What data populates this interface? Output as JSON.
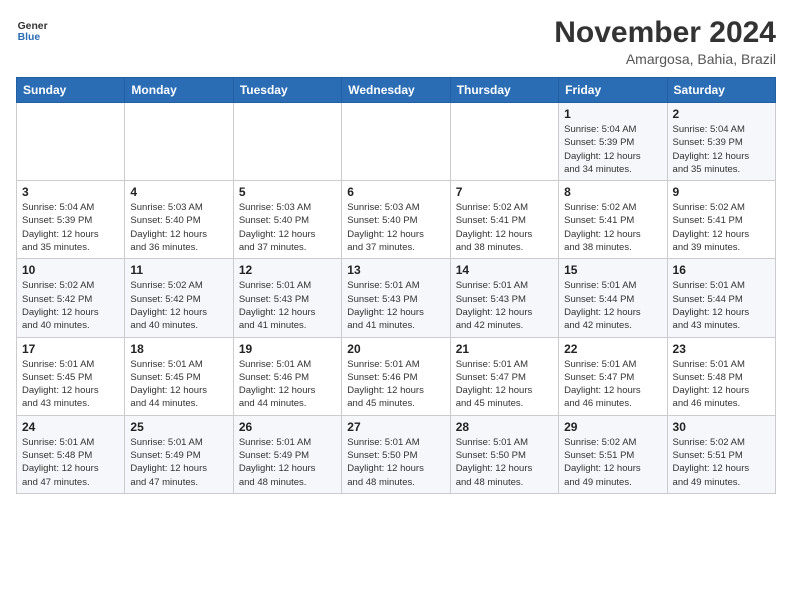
{
  "logo": {
    "line1": "General",
    "line2": "Blue"
  },
  "title": "November 2024",
  "location": "Amargosa, Bahia, Brazil",
  "days_of_week": [
    "Sunday",
    "Monday",
    "Tuesday",
    "Wednesday",
    "Thursday",
    "Friday",
    "Saturday"
  ],
  "weeks": [
    [
      {
        "day": "",
        "info": ""
      },
      {
        "day": "",
        "info": ""
      },
      {
        "day": "",
        "info": ""
      },
      {
        "day": "",
        "info": ""
      },
      {
        "day": "",
        "info": ""
      },
      {
        "day": "1",
        "info": "Sunrise: 5:04 AM\nSunset: 5:39 PM\nDaylight: 12 hours\nand 34 minutes."
      },
      {
        "day": "2",
        "info": "Sunrise: 5:04 AM\nSunset: 5:39 PM\nDaylight: 12 hours\nand 35 minutes."
      }
    ],
    [
      {
        "day": "3",
        "info": "Sunrise: 5:04 AM\nSunset: 5:39 PM\nDaylight: 12 hours\nand 35 minutes."
      },
      {
        "day": "4",
        "info": "Sunrise: 5:03 AM\nSunset: 5:40 PM\nDaylight: 12 hours\nand 36 minutes."
      },
      {
        "day": "5",
        "info": "Sunrise: 5:03 AM\nSunset: 5:40 PM\nDaylight: 12 hours\nand 37 minutes."
      },
      {
        "day": "6",
        "info": "Sunrise: 5:03 AM\nSunset: 5:40 PM\nDaylight: 12 hours\nand 37 minutes."
      },
      {
        "day": "7",
        "info": "Sunrise: 5:02 AM\nSunset: 5:41 PM\nDaylight: 12 hours\nand 38 minutes."
      },
      {
        "day": "8",
        "info": "Sunrise: 5:02 AM\nSunset: 5:41 PM\nDaylight: 12 hours\nand 38 minutes."
      },
      {
        "day": "9",
        "info": "Sunrise: 5:02 AM\nSunset: 5:41 PM\nDaylight: 12 hours\nand 39 minutes."
      }
    ],
    [
      {
        "day": "10",
        "info": "Sunrise: 5:02 AM\nSunset: 5:42 PM\nDaylight: 12 hours\nand 40 minutes."
      },
      {
        "day": "11",
        "info": "Sunrise: 5:02 AM\nSunset: 5:42 PM\nDaylight: 12 hours\nand 40 minutes."
      },
      {
        "day": "12",
        "info": "Sunrise: 5:01 AM\nSunset: 5:43 PM\nDaylight: 12 hours\nand 41 minutes."
      },
      {
        "day": "13",
        "info": "Sunrise: 5:01 AM\nSunset: 5:43 PM\nDaylight: 12 hours\nand 41 minutes."
      },
      {
        "day": "14",
        "info": "Sunrise: 5:01 AM\nSunset: 5:43 PM\nDaylight: 12 hours\nand 42 minutes."
      },
      {
        "day": "15",
        "info": "Sunrise: 5:01 AM\nSunset: 5:44 PM\nDaylight: 12 hours\nand 42 minutes."
      },
      {
        "day": "16",
        "info": "Sunrise: 5:01 AM\nSunset: 5:44 PM\nDaylight: 12 hours\nand 43 minutes."
      }
    ],
    [
      {
        "day": "17",
        "info": "Sunrise: 5:01 AM\nSunset: 5:45 PM\nDaylight: 12 hours\nand 43 minutes."
      },
      {
        "day": "18",
        "info": "Sunrise: 5:01 AM\nSunset: 5:45 PM\nDaylight: 12 hours\nand 44 minutes."
      },
      {
        "day": "19",
        "info": "Sunrise: 5:01 AM\nSunset: 5:46 PM\nDaylight: 12 hours\nand 44 minutes."
      },
      {
        "day": "20",
        "info": "Sunrise: 5:01 AM\nSunset: 5:46 PM\nDaylight: 12 hours\nand 45 minutes."
      },
      {
        "day": "21",
        "info": "Sunrise: 5:01 AM\nSunset: 5:47 PM\nDaylight: 12 hours\nand 45 minutes."
      },
      {
        "day": "22",
        "info": "Sunrise: 5:01 AM\nSunset: 5:47 PM\nDaylight: 12 hours\nand 46 minutes."
      },
      {
        "day": "23",
        "info": "Sunrise: 5:01 AM\nSunset: 5:48 PM\nDaylight: 12 hours\nand 46 minutes."
      }
    ],
    [
      {
        "day": "24",
        "info": "Sunrise: 5:01 AM\nSunset: 5:48 PM\nDaylight: 12 hours\nand 47 minutes."
      },
      {
        "day": "25",
        "info": "Sunrise: 5:01 AM\nSunset: 5:49 PM\nDaylight: 12 hours\nand 47 minutes."
      },
      {
        "day": "26",
        "info": "Sunrise: 5:01 AM\nSunset: 5:49 PM\nDaylight: 12 hours\nand 48 minutes."
      },
      {
        "day": "27",
        "info": "Sunrise: 5:01 AM\nSunset: 5:50 PM\nDaylight: 12 hours\nand 48 minutes."
      },
      {
        "day": "28",
        "info": "Sunrise: 5:01 AM\nSunset: 5:50 PM\nDaylight: 12 hours\nand 48 minutes."
      },
      {
        "day": "29",
        "info": "Sunrise: 5:02 AM\nSunset: 5:51 PM\nDaylight: 12 hours\nand 49 minutes."
      },
      {
        "day": "30",
        "info": "Sunrise: 5:02 AM\nSunset: 5:51 PM\nDaylight: 12 hours\nand 49 minutes."
      }
    ]
  ]
}
